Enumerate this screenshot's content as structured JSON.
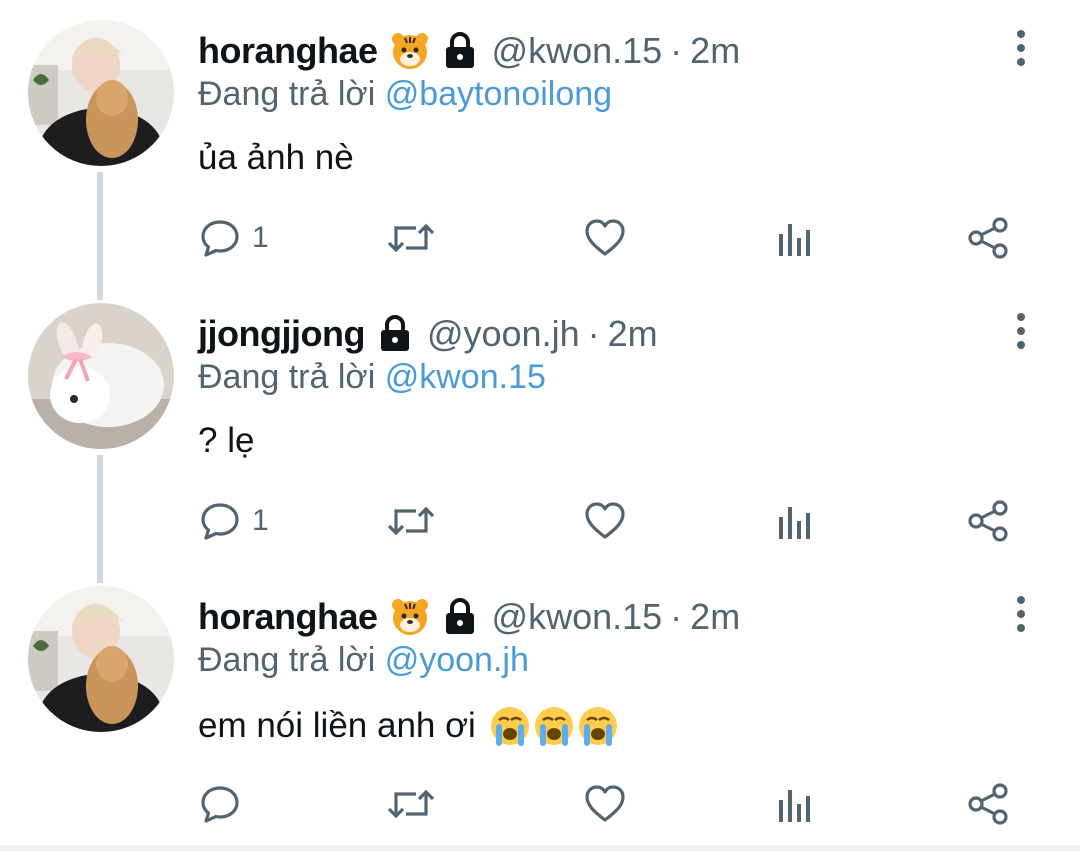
{
  "tweets": [
    {
      "author": {
        "name": "horanghae",
        "handle": "@kwon.15",
        "badges": [
          "tiger-face-emoji",
          "lock-icon"
        ],
        "avatar": "person-with-dog-avatar"
      },
      "time": "2m",
      "replying_prefix": "Đang trả lời",
      "replying_to": "@baytonoilong",
      "text": "ủa ảnh nè",
      "emojis": [],
      "replies": "1"
    },
    {
      "author": {
        "name": "jjongjjong",
        "handle": "@yoon.jh",
        "badges": [
          "lock-icon"
        ],
        "avatar": "white-rabbit-with-pink-bow-avatar"
      },
      "time": "2m",
      "replying_prefix": "Đang trả lời",
      "replying_to": "@kwon.15",
      "text": "? lẹ",
      "emojis": [],
      "replies": "1"
    },
    {
      "author": {
        "name": "horanghae",
        "handle": "@kwon.15",
        "badges": [
          "tiger-face-emoji",
          "lock-icon"
        ],
        "avatar": "person-with-dog-avatar"
      },
      "time": "2m",
      "replying_prefix": "Đang trả lời",
      "replying_to": "@yoon.jh",
      "text": "em nói liền anh ơi",
      "emojis": [
        "loudly-crying-face",
        "loudly-crying-face",
        "loudly-crying-face"
      ],
      "replies": ""
    }
  ],
  "separator": "·",
  "icons": [
    "reply-icon",
    "retweet-icon",
    "like-icon",
    "views-icon",
    "share-icon",
    "more-options-icon"
  ],
  "colors": {
    "mention": "#4a9ad8",
    "secondary_text": "#536471",
    "thread_line": "#cfd9de"
  }
}
